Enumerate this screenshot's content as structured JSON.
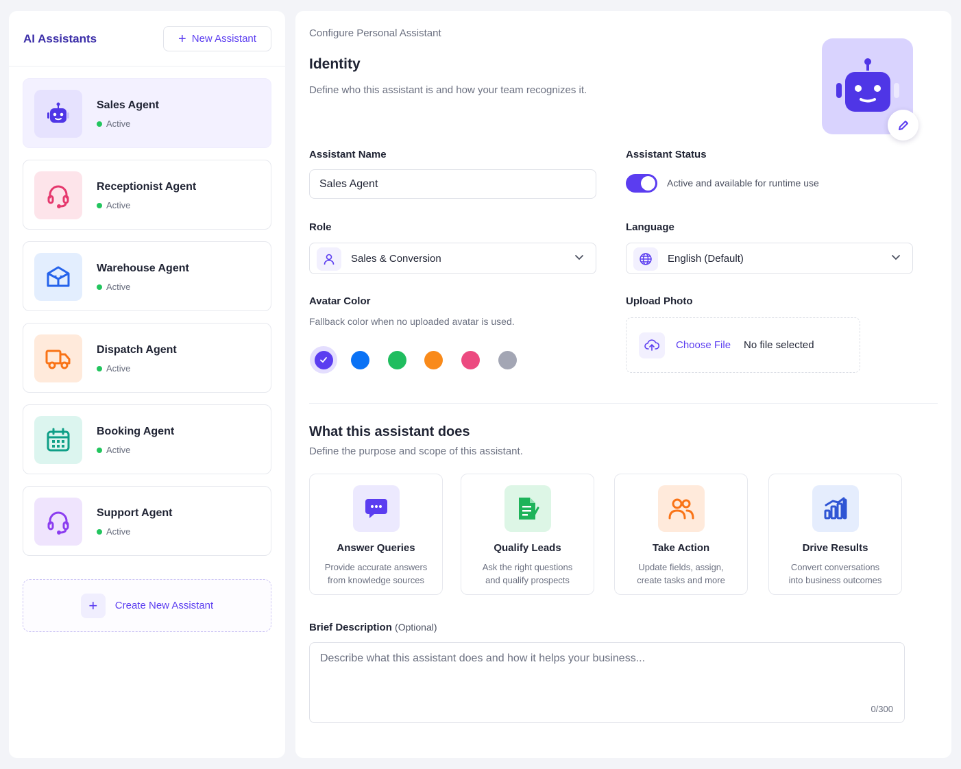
{
  "sidebar": {
    "title": "AI Assistants",
    "new_button": "New Assistant",
    "agents": [
      {
        "name": "Sales Agent",
        "status": "Active",
        "icon": "robot-icon",
        "bg": "#e6e2fe",
        "color": "#4f36e6",
        "selected": true
      },
      {
        "name": "Receptionist Agent",
        "status": "Active",
        "icon": "headset-icon",
        "bg": "#fde4ea",
        "color": "#e5386d",
        "selected": false
      },
      {
        "name": "Warehouse Agent",
        "status": "Active",
        "icon": "box-icon",
        "bg": "#e3eefe",
        "color": "#2563eb",
        "selected": false
      },
      {
        "name": "Dispatch Agent",
        "status": "Active",
        "icon": "truck-icon",
        "bg": "#ffeadb",
        "color": "#f97316",
        "selected": false
      },
      {
        "name": "Booking Agent",
        "status": "Active",
        "icon": "calendar-icon",
        "bg": "#dcf5ef",
        "color": "#0f9f87",
        "selected": false
      },
      {
        "name": "Support Agent",
        "status": "Active",
        "icon": "headset-icon",
        "bg": "#efe4fd",
        "color": "#8b3df0",
        "selected": false
      }
    ],
    "create_button": "Create New Assistant"
  },
  "main": {
    "breadcrumb": "Configure Personal Assistant",
    "identity_title": "Identity",
    "identity_subtitle": "Define who this assistant is and how your team recognizes it.",
    "name_label": "Assistant Name",
    "name_value": "Sales Agent",
    "status_label": "Assistant Status",
    "status_on": true,
    "status_text": "Active and available for runtime use",
    "role_label": "Role",
    "role_value": "Sales & Conversion",
    "language_label": "Language",
    "language_value": "English (Default)",
    "avatar_color_label": "Avatar Color",
    "avatar_color_hint": "Fallback color when no uploaded avatar is used.",
    "avatar_colors": [
      "#5b3df0",
      "#0a72f5",
      "#20bd5f",
      "#f98a1a",
      "#ec4a80",
      "#a3a6b4"
    ],
    "selected_color": "#5b3df0",
    "upload_label": "Upload Photo",
    "choose_file": "Choose File",
    "no_file": "No file selected",
    "does_title": "What this assistant does",
    "does_subtitle": "Define the purpose and scope of this assistant.",
    "capabilities": [
      {
        "title": "Answer Queries",
        "desc1": "Provide accurate answers",
        "desc2": "from knowledge sources",
        "icon": "chat-icon",
        "bg": "#ece9fe",
        "color": "#5b3df0"
      },
      {
        "title": "Qualify Leads",
        "desc1": "Ask the right questions",
        "desc2": "and qualify prospects",
        "icon": "document-check-icon",
        "bg": "#ddf6e6",
        "color": "#1eb35a"
      },
      {
        "title": "Take Action",
        "desc1": "Update fields, assign,",
        "desc2": "create tasks and more",
        "icon": "users-icon",
        "bg": "#ffeadb",
        "color": "#f97316"
      },
      {
        "title": "Drive Results",
        "desc1": "Convert conversations",
        "desc2": "into business outcomes",
        "icon": "bar-chart-icon",
        "bg": "#e5edfd",
        "color": "#2f55d4"
      }
    ],
    "description_label": "Brief Description",
    "description_optional": "(Optional)",
    "description_placeholder": "Describe what this assistant does and how it helps your business...",
    "description_count": "0/300"
  }
}
